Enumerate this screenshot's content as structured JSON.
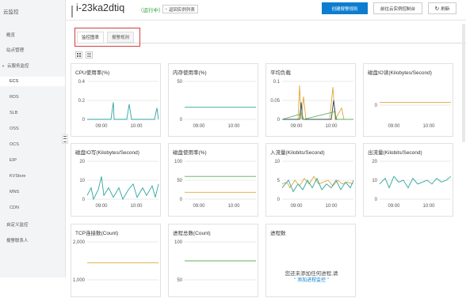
{
  "sidebar": {
    "title": "云监控",
    "items": [
      {
        "label": "概览",
        "kind": "item"
      },
      {
        "label": "站点管理",
        "kind": "item"
      },
      {
        "label": "云服务监控",
        "kind": "group"
      },
      {
        "label": "ECS",
        "kind": "active"
      },
      {
        "label": "RDS",
        "kind": "sub"
      },
      {
        "label": "SLB",
        "kind": "sub"
      },
      {
        "label": "OSS",
        "kind": "sub"
      },
      {
        "label": "OCS",
        "kind": "sub"
      },
      {
        "label": "EIP",
        "kind": "sub"
      },
      {
        "label": "KVStore",
        "kind": "sub"
      },
      {
        "label": "MNS",
        "kind": "sub"
      },
      {
        "label": "CDN",
        "kind": "sub"
      },
      {
        "label": "自定义监控",
        "kind": "item"
      },
      {
        "label": "报警联系人",
        "kind": "item"
      }
    ]
  },
  "header": {
    "instance_id": "i-23ka2dtiq",
    "status": "（运行中）",
    "back_label": "返回实例列表",
    "create_alarm_label": "创建报警规则",
    "console_label": "前往云实例控制台",
    "refresh_label": "刷新"
  },
  "tabs": [
    {
      "label": "监控图表",
      "active": true
    },
    {
      "label": "报警规则",
      "active": false
    }
  ],
  "colors": {
    "teal": "#2fa6a0",
    "orange": "#e0a83c",
    "dark": "#2f4a56",
    "green": "#5fae5b",
    "grid": "#e2e2e2",
    "primary": "#0d7dcf"
  },
  "charts": [
    {
      "title": "CPU使用率(%)",
      "yticks": [
        "0.4",
        "0.2",
        "0"
      ],
      "xticks": [
        "09:00",
        "10:00"
      ]
    },
    {
      "title": "内存使用率(%)",
      "yticks": [
        "50",
        "0"
      ],
      "xticks": [
        "09:00",
        "10:00"
      ]
    },
    {
      "title": "平均负载",
      "yticks": [
        "0.1",
        "0.05",
        "0"
      ],
      "xticks": [
        "09:00",
        "10:00"
      ]
    },
    {
      "title": "磁盘IO读(Kilobytes/Second)",
      "yticks": [
        "0"
      ],
      "xticks": [
        "09:00",
        "10:00"
      ]
    },
    {
      "title": "磁盘IO写(Kilobytes/Second)",
      "yticks": [
        "20",
        "10",
        "0"
      ],
      "xticks": [
        "09:00",
        "10:00"
      ]
    },
    {
      "title": "磁盘使用率(%)",
      "yticks": [
        "100",
        "50",
        "0"
      ],
      "xticks": [
        "09:00",
        "10:00"
      ]
    },
    {
      "title": "入流量(Kilobits/Second)",
      "yticks": [
        "10",
        "5",
        "0"
      ],
      "xticks": [
        "09:00",
        "10:00"
      ]
    },
    {
      "title": "出流量(Kilobits/Second)",
      "yticks": [
        "20",
        "10",
        "0"
      ],
      "xticks": [
        "09:00",
        "10:00"
      ]
    },
    {
      "title": "TCP连接数(Count)",
      "yticks": [
        "2,000",
        "1,000"
      ],
      "xticks": []
    },
    {
      "title": "进程总数(Count)",
      "yticks": [
        "100",
        "50"
      ],
      "xticks": []
    },
    {
      "title": "进程数",
      "yticks": [],
      "xticks": []
    }
  ],
  "empty_state": {
    "message": "您还未添加任何进程,请",
    "link": "添加进程监控"
  }
}
